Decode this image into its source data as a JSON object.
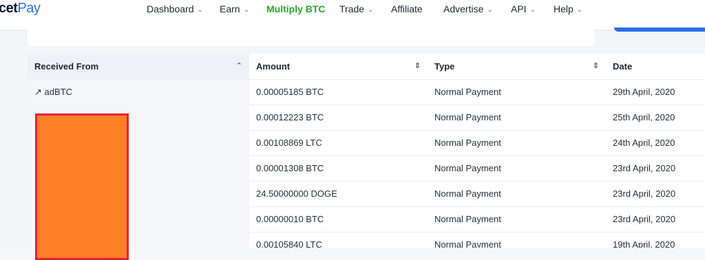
{
  "brand": {
    "prefix": "cet",
    "suffix": "Pay"
  },
  "nav": [
    {
      "label": "Dashboard",
      "dropdown": true
    },
    {
      "label": "Earn",
      "dropdown": true
    },
    {
      "label": "Multiply BTC",
      "dropdown": false,
      "active": true
    },
    {
      "label": "Trade",
      "dropdown": true
    },
    {
      "label": "Affiliate",
      "dropdown": false
    },
    {
      "label": "Advertise",
      "dropdown": true
    },
    {
      "label": "API",
      "dropdown": true
    },
    {
      "label": "Help",
      "dropdown": true
    }
  ],
  "table": {
    "headers": {
      "received_from": "Received From",
      "amount": "Amount",
      "type": "Type",
      "date": "Date"
    },
    "rows": [
      {
        "from": "↗ adBTC",
        "amount": "0.00005185 BTC",
        "type": "Normal Payment",
        "date": "29th April, 2020"
      },
      {
        "from": "",
        "amount": "0.00012223 BTC",
        "type": "Normal Payment",
        "date": "25th April, 2020"
      },
      {
        "from": "",
        "amount": "0.00108869 LTC",
        "type": "Normal Payment",
        "date": "24th April, 2020"
      },
      {
        "from": "",
        "amount": "0.00001308 BTC",
        "type": "Normal Payment",
        "date": "23rd April, 2020"
      },
      {
        "from": "",
        "amount": "24.50000000 DOGE",
        "type": "Normal Payment",
        "date": "23rd April, 2020"
      },
      {
        "from": "",
        "amount": "0.00000010 BTC",
        "type": "Normal Payment",
        "date": "23rd April, 2020"
      },
      {
        "from": "",
        "amount": "0.00105840 LTC",
        "type": "Normal Payment",
        "date": "19th April, 2020"
      }
    ]
  },
  "colors": {
    "accent": "#2f6fe8",
    "active_nav": "#2aa82a",
    "redaction_fill": "#ff7f27",
    "redaction_border": "#e2232a"
  }
}
